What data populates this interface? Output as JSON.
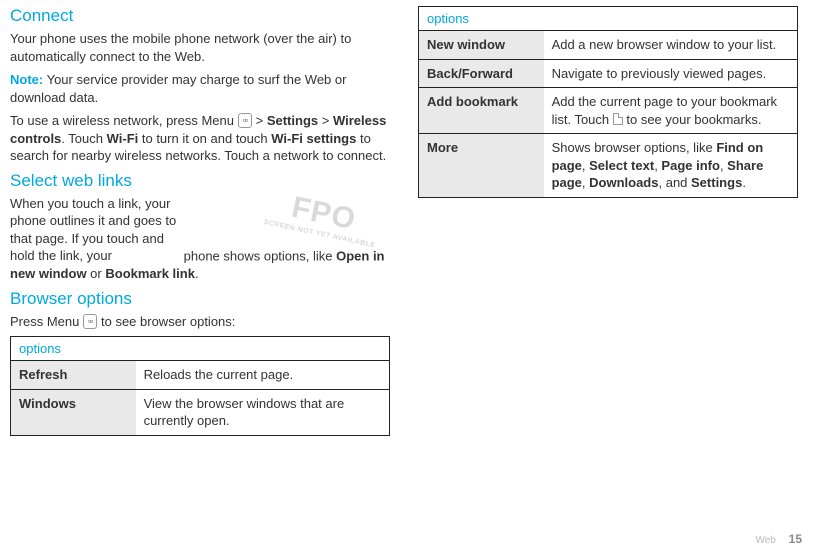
{
  "left": {
    "connect_title": "Connect",
    "connect_p1": "Your phone uses the mobile phone network (over the air) to automatically connect to the Web.",
    "note_label": "Note:",
    "note_text": " Your service provider may charge to surf the Web or download data.",
    "wireless_pre": "To use a wireless network, press Menu ",
    "gt1": " > ",
    "settings": "Settings",
    "gt2": " > ",
    "wireless_controls": "Wireless controls",
    "touch_txt": ". Touch ",
    "wifi": "Wi-Fi",
    "turnon": " to turn it on and touch ",
    "wifi_settings": "Wi-Fi settings",
    "search_txt": " to search for nearby wireless networks. Touch a network to connect.",
    "select_title": "Select web links",
    "select_p_a": "When you touch a link, your phone outlines it and goes to that page. If you touch and hold the link, your ",
    "select_p_b": "phone shows options, like ",
    "open_new": "Open in new window",
    "or_txt": " or ",
    "bookmark_link": "Bookmark link",
    "period": ".",
    "fpo_big": "FPO",
    "fpo_small": "SCREEN NOT YET AVAILABLE",
    "browser_title": "Browser options",
    "browser_intro_a": "Press Menu ",
    "browser_intro_b": " to see browser options:",
    "table_header": "options",
    "row1_key": "Refresh",
    "row1_val": "Reloads the current page.",
    "row2_key": "Windows",
    "row2_val": "View the browser windows that are currently open."
  },
  "right": {
    "table_header": "options",
    "row1_key": "New window",
    "row1_val": "Add a new browser window to your list.",
    "row2_key": "Back/Forward",
    "row2_val": "Navigate to previously viewed pages.",
    "row3_key": "Add bookmark",
    "row3_val_a": "Add the current page to your bookmark list. Touch ",
    "row3_val_b": " to see your bookmarks.",
    "row4_key": "More",
    "row4_val_a": "Shows browser options, like ",
    "row4_find": "Find on page",
    "row4_c1": ", ",
    "row4_select": "Select text",
    "row4_c2": ", ",
    "row4_pageinfo": "Page info",
    "row4_c3": ", ",
    "row4_share": "Share page",
    "row4_c4": ", ",
    "row4_downloads": "Downloads",
    "row4_and": ", and ",
    "row4_settings": "Settings",
    "row4_period": "."
  },
  "menu_glyph": "▫▫",
  "footer": {
    "section": "Web",
    "page": "15"
  }
}
